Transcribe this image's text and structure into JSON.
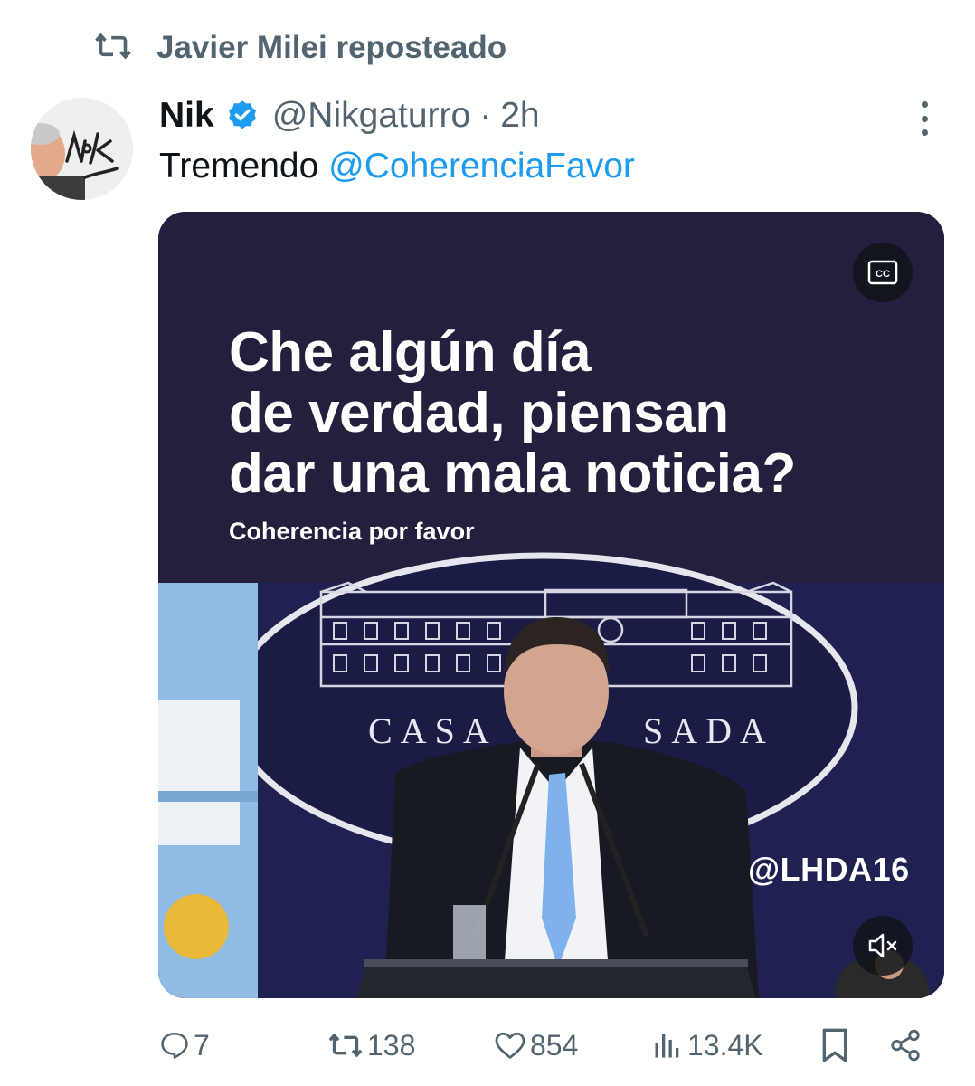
{
  "repost": {
    "label": "Javier Milei reposteado",
    "icon": "repost-icon"
  },
  "author": {
    "name": "Nik",
    "handle": "@Nikgaturro",
    "separator": "·",
    "time": "2h",
    "verified": true,
    "badge_color": "#1d9bf0"
  },
  "tweet": {
    "text": "Tremendo ",
    "mention": "@CoherenciaFavor"
  },
  "media": {
    "headline_lines": [
      "Che algún día",
      "de verdad, piensan",
      "dar una mala noticia?"
    ],
    "subtitle": "Coherencia por favor",
    "watermark": "@LHDA16",
    "backdrop_text_left": "CASA",
    "backdrop_text_right": "SADA",
    "cc_label": "CC",
    "background_color": "#241f3d"
  },
  "actions": {
    "reply_count": "7",
    "repost_count": "138",
    "like_count": "854",
    "views_count": "13.4K"
  },
  "colors": {
    "secondary_text": "#536471",
    "link": "#1d9bf0",
    "primary_text": "#0f1419"
  }
}
